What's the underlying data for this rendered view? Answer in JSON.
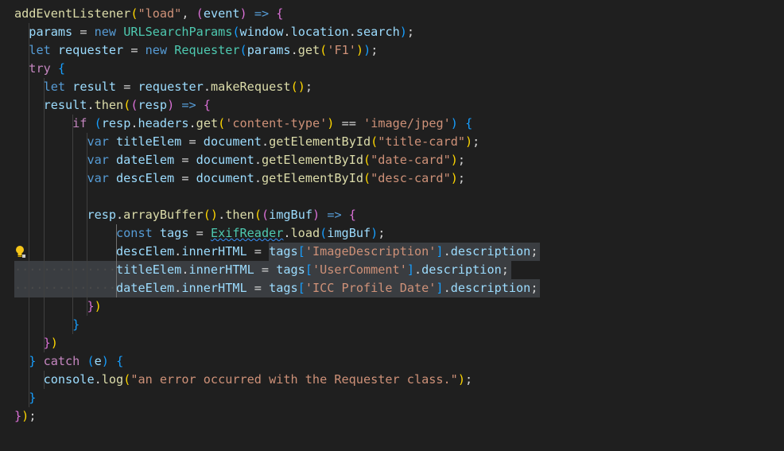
{
  "editor": {
    "lines": [
      "addEventListener(\"load\", (event) => {",
      "  params = new URLSearchParams(window.location.search);",
      "  let requester = new Requester(params.get('F1'));",
      "  try {",
      "    let result = requester.makeRequest();",
      "    result.then((resp) => {",
      "        if (resp.headers.get('content-type') == 'image/jpeg') {",
      "          var titleElem = document.getElementById(\"title-card\");",
      "          var dateElem = document.getElementById(\"date-card\");",
      "          var descElem = document.getElementById(\"desc-card\");",
      "",
      "          resp.arrayBuffer().then((imgBuf) => {",
      "              const tags = ExifReader.load(imgBuf);",
      "              descElem.innerHTML = tags['ImageDescription'].description;",
      "              titleElem.innerHTML = tags['UserComment'].description;",
      "              dateElem.innerHTML = tags['ICC Profile Date'].description;",
      "          })",
      "        }",
      "    })",
      "  } catch (e) {",
      "    console.log(\"an error occurred with the Requester class.\");",
      "  }",
      "});"
    ],
    "lightbulb_icon": "lightbulb-icon",
    "colors": {
      "background": "#1f1f1f",
      "keyword": "#569cd6",
      "control": "#c586c0",
      "variable": "#9cdcfe",
      "function": "#dcdcaa",
      "class": "#4ec9b0",
      "string": "#ce9178",
      "selection": "#3a3d41"
    }
  }
}
